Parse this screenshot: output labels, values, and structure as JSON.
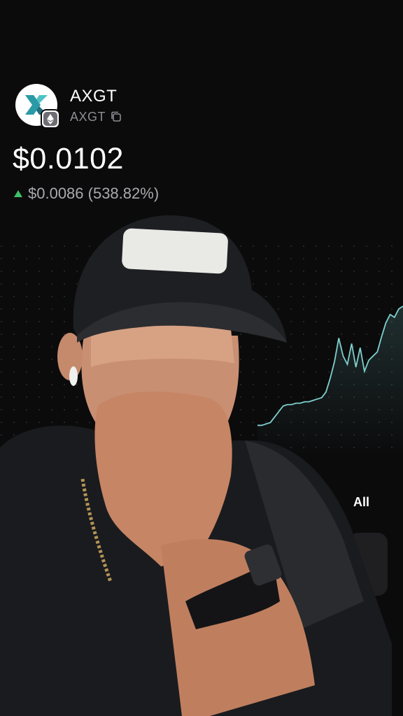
{
  "token": {
    "name": "AXGT",
    "ticker": "AXGT",
    "logo_icon": "axgt-logo-icon",
    "network_badge_icon": "ethereum-icon",
    "copy_icon": "copy-icon"
  },
  "price": {
    "current": "$0.0102",
    "change": "$0.0086 (538.82%)",
    "direction_icon": "triangle-up-icon"
  },
  "chart": {
    "line_color": "#7fd0cf",
    "range_selected": "All"
  },
  "chart_data": {
    "type": "line",
    "series": [
      {
        "values": [
          0.0016,
          0.0016,
          0.0017,
          0.0018,
          0.0022,
          0.0026,
          0.003,
          0.0031,
          0.0031,
          0.0032,
          0.0032,
          0.0033,
          0.0033,
          0.0034,
          0.0035,
          0.0036,
          0.004,
          0.005,
          0.0062,
          0.0079,
          0.0066,
          0.006,
          0.0075,
          0.0058,
          0.0072,
          0.0055,
          0.0063,
          0.0066,
          0.0069,
          0.008,
          0.009,
          0.0096,
          0.0094,
          0.01,
          0.0102
        ]
      }
    ]
  },
  "overlay": {
    "person_icon": "person-webcam-overlay"
  }
}
